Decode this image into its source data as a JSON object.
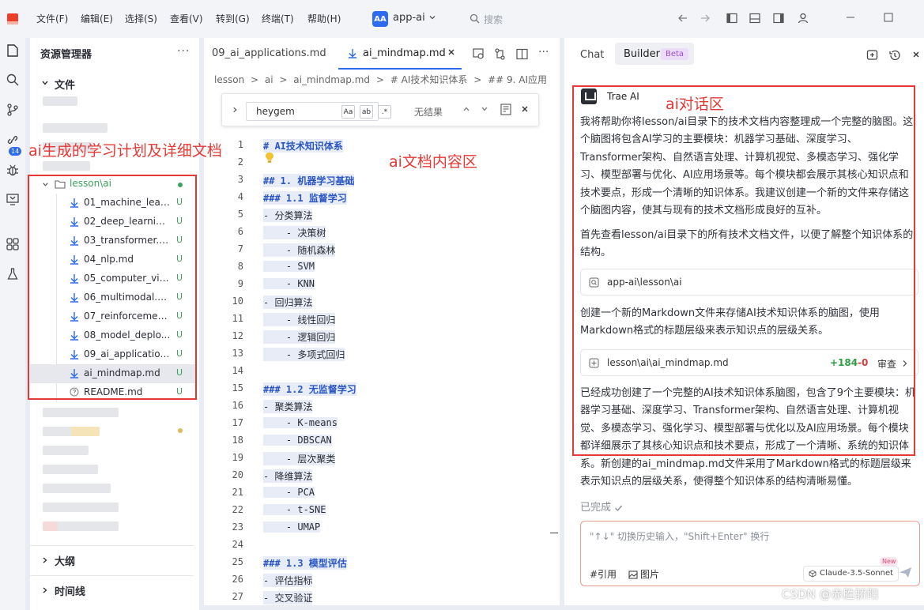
{
  "titlebar": {
    "menus": [
      "文件(F)",
      "编辑(E)",
      "选择(S)",
      "查看(V)",
      "转到(G)",
      "终端(T)",
      "帮助(H)"
    ],
    "app_badge": "AA",
    "app_name": "app-ai",
    "search_placeholder": "搜索"
  },
  "activity": {
    "badge": "14"
  },
  "explorer": {
    "title": "资源管理器",
    "more": "···",
    "section_files": "文件",
    "folder": "lesson\\ai",
    "files": [
      {
        "name": "01_machine_lear...",
        "status": "U"
      },
      {
        "name": "02_deep_learnin...",
        "status": "U"
      },
      {
        "name": "03_transformer.md",
        "status": "U"
      },
      {
        "name": "04_nlp.md",
        "status": "U"
      },
      {
        "name": "05_computer_visi...",
        "status": "U"
      },
      {
        "name": "06_multimodal.md",
        "status": "U"
      },
      {
        "name": "07_reinforcemen...",
        "status": "U"
      },
      {
        "name": "08_model_deplo...",
        "status": "U"
      },
      {
        "name": "09_ai_application...",
        "status": "U"
      },
      {
        "name": "ai_mindmap.md",
        "status": "U"
      },
      {
        "name": "README.md",
        "status": "U"
      }
    ],
    "section_outline": "大纲",
    "section_timeline": "时间线"
  },
  "editor": {
    "tabs": [
      "09_ai_applications.md",
      "ai_mindmap.md"
    ],
    "breadcrumb": [
      "lesson",
      ">",
      "ai",
      ">",
      "ai_mindmap.md",
      ">",
      "# AI技术知识体系",
      ">",
      "## 9. AI应用"
    ],
    "find": {
      "value": "heygem",
      "opts": [
        "Aa",
        "ab",
        ".*"
      ],
      "result": "无结果"
    },
    "lines": [
      {
        "n": "1",
        "text": "# AI技术知识体系"
      },
      {
        "n": "2",
        "text": ""
      },
      {
        "n": "3",
        "text": "## 1. 机器学习基础"
      },
      {
        "n": "4",
        "text": "### 1.1 监督学习"
      },
      {
        "n": "5",
        "text": "- 分类算法"
      },
      {
        "n": "6",
        "text": "    - 决策树"
      },
      {
        "n": "7",
        "text": "    - 随机森林"
      },
      {
        "n": "8",
        "text": "    - SVM"
      },
      {
        "n": "9",
        "text": "    - KNN"
      },
      {
        "n": "10",
        "text": "- 回归算法"
      },
      {
        "n": "11",
        "text": "    - 线性回归"
      },
      {
        "n": "12",
        "text": "    - 逻辑回归"
      },
      {
        "n": "13",
        "text": "    - 多项式回归"
      },
      {
        "n": "14",
        "text": ""
      },
      {
        "n": "15",
        "text": "### 1.2 无监督学习"
      },
      {
        "n": "16",
        "text": "- 聚类算法"
      },
      {
        "n": "17",
        "text": "    - K-means"
      },
      {
        "n": "18",
        "text": "    - DBSCAN"
      },
      {
        "n": "19",
        "text": "    - 层次聚类"
      },
      {
        "n": "20",
        "text": "- 降维算法"
      },
      {
        "n": "21",
        "text": "    - PCA"
      },
      {
        "n": "22",
        "text": "    - t-SNE"
      },
      {
        "n": "23",
        "text": "    - UMAP"
      },
      {
        "n": "24",
        "text": ""
      },
      {
        "n": "25",
        "text": "### 1.3 模型评估"
      },
      {
        "n": "26",
        "text": "- 评估指标"
      },
      {
        "n": "27",
        "text": "- 交叉验证"
      }
    ]
  },
  "chat": {
    "tab_chat": "Chat",
    "tab_builder": "Builder",
    "beta": "Beta",
    "ai_name": "Trae AI",
    "para1": "我将帮助你将lesson/ai目录下的技术文档内容整理成一个完整的脑图。这个脑图将包含AI学习的主要模块：机器学习基础、深度学习、Transformer架构、自然语言处理、计算机视觉、多模态学习、强化学习、模型部署与优化、AI应用场景等。每个模块都会展示其核心知识点和技术要点，形成一个清晰的知识体系。我建议创建一个新的文件来存储这个脑图内容，使其与现有的技术文档形成良好的互补。",
    "para2": "首先查看lesson/ai目录下的所有技术文档文件，以便了解整个知识体系的结构。",
    "card1": "app-ai\\lesson\\ai",
    "para3": "创建一个新的Markdown文件来存储AI技术知识体系的脑图，使用Markdown格式的标题层级来表示知识点的层级关系。",
    "card2": {
      "path": "lesson\\ai\\ai_mindmap.md",
      "added": "+184",
      "removed": "-0",
      "review": "审查"
    },
    "para4": "已经成功创建了一个完整的AI技术知识体系脑图，包含了9个主要模块：机器学习基础、深度学习、Transformer架构、自然语言处理、计算机视觉、多模态学习、强化学习、模型部署与优化以及AI应用场景。每个模块都详细展示了其核心知识点和技术要点，形成了一个清晰、系统的知识体系。新创建的ai_mindmap.md文件采用了Markdown格式的标题层级来表示知识点的层级关系，使得整个知识体系的结构清晰易懂。",
    "done": "已完成",
    "input_placeholder": "\"↑↓\" 切换历史输入，\"Shift+Enter\" 换行",
    "cite": "#引用",
    "image": "图片",
    "model": "Claude-3.5-Sonnet",
    "new_tag": "New"
  },
  "annotations": {
    "explorer_label": "ai生成的学习计划及详细文档",
    "editor_label": "ai文档内容区",
    "chat_label": "ai对话区"
  },
  "watermark": "CSDN @赤胜骄阳",
  "colors": {
    "accent": "#2d6bf0",
    "untracked": "#3aa35b",
    "annotation": "#e53935",
    "heading": "#2a56c6"
  }
}
